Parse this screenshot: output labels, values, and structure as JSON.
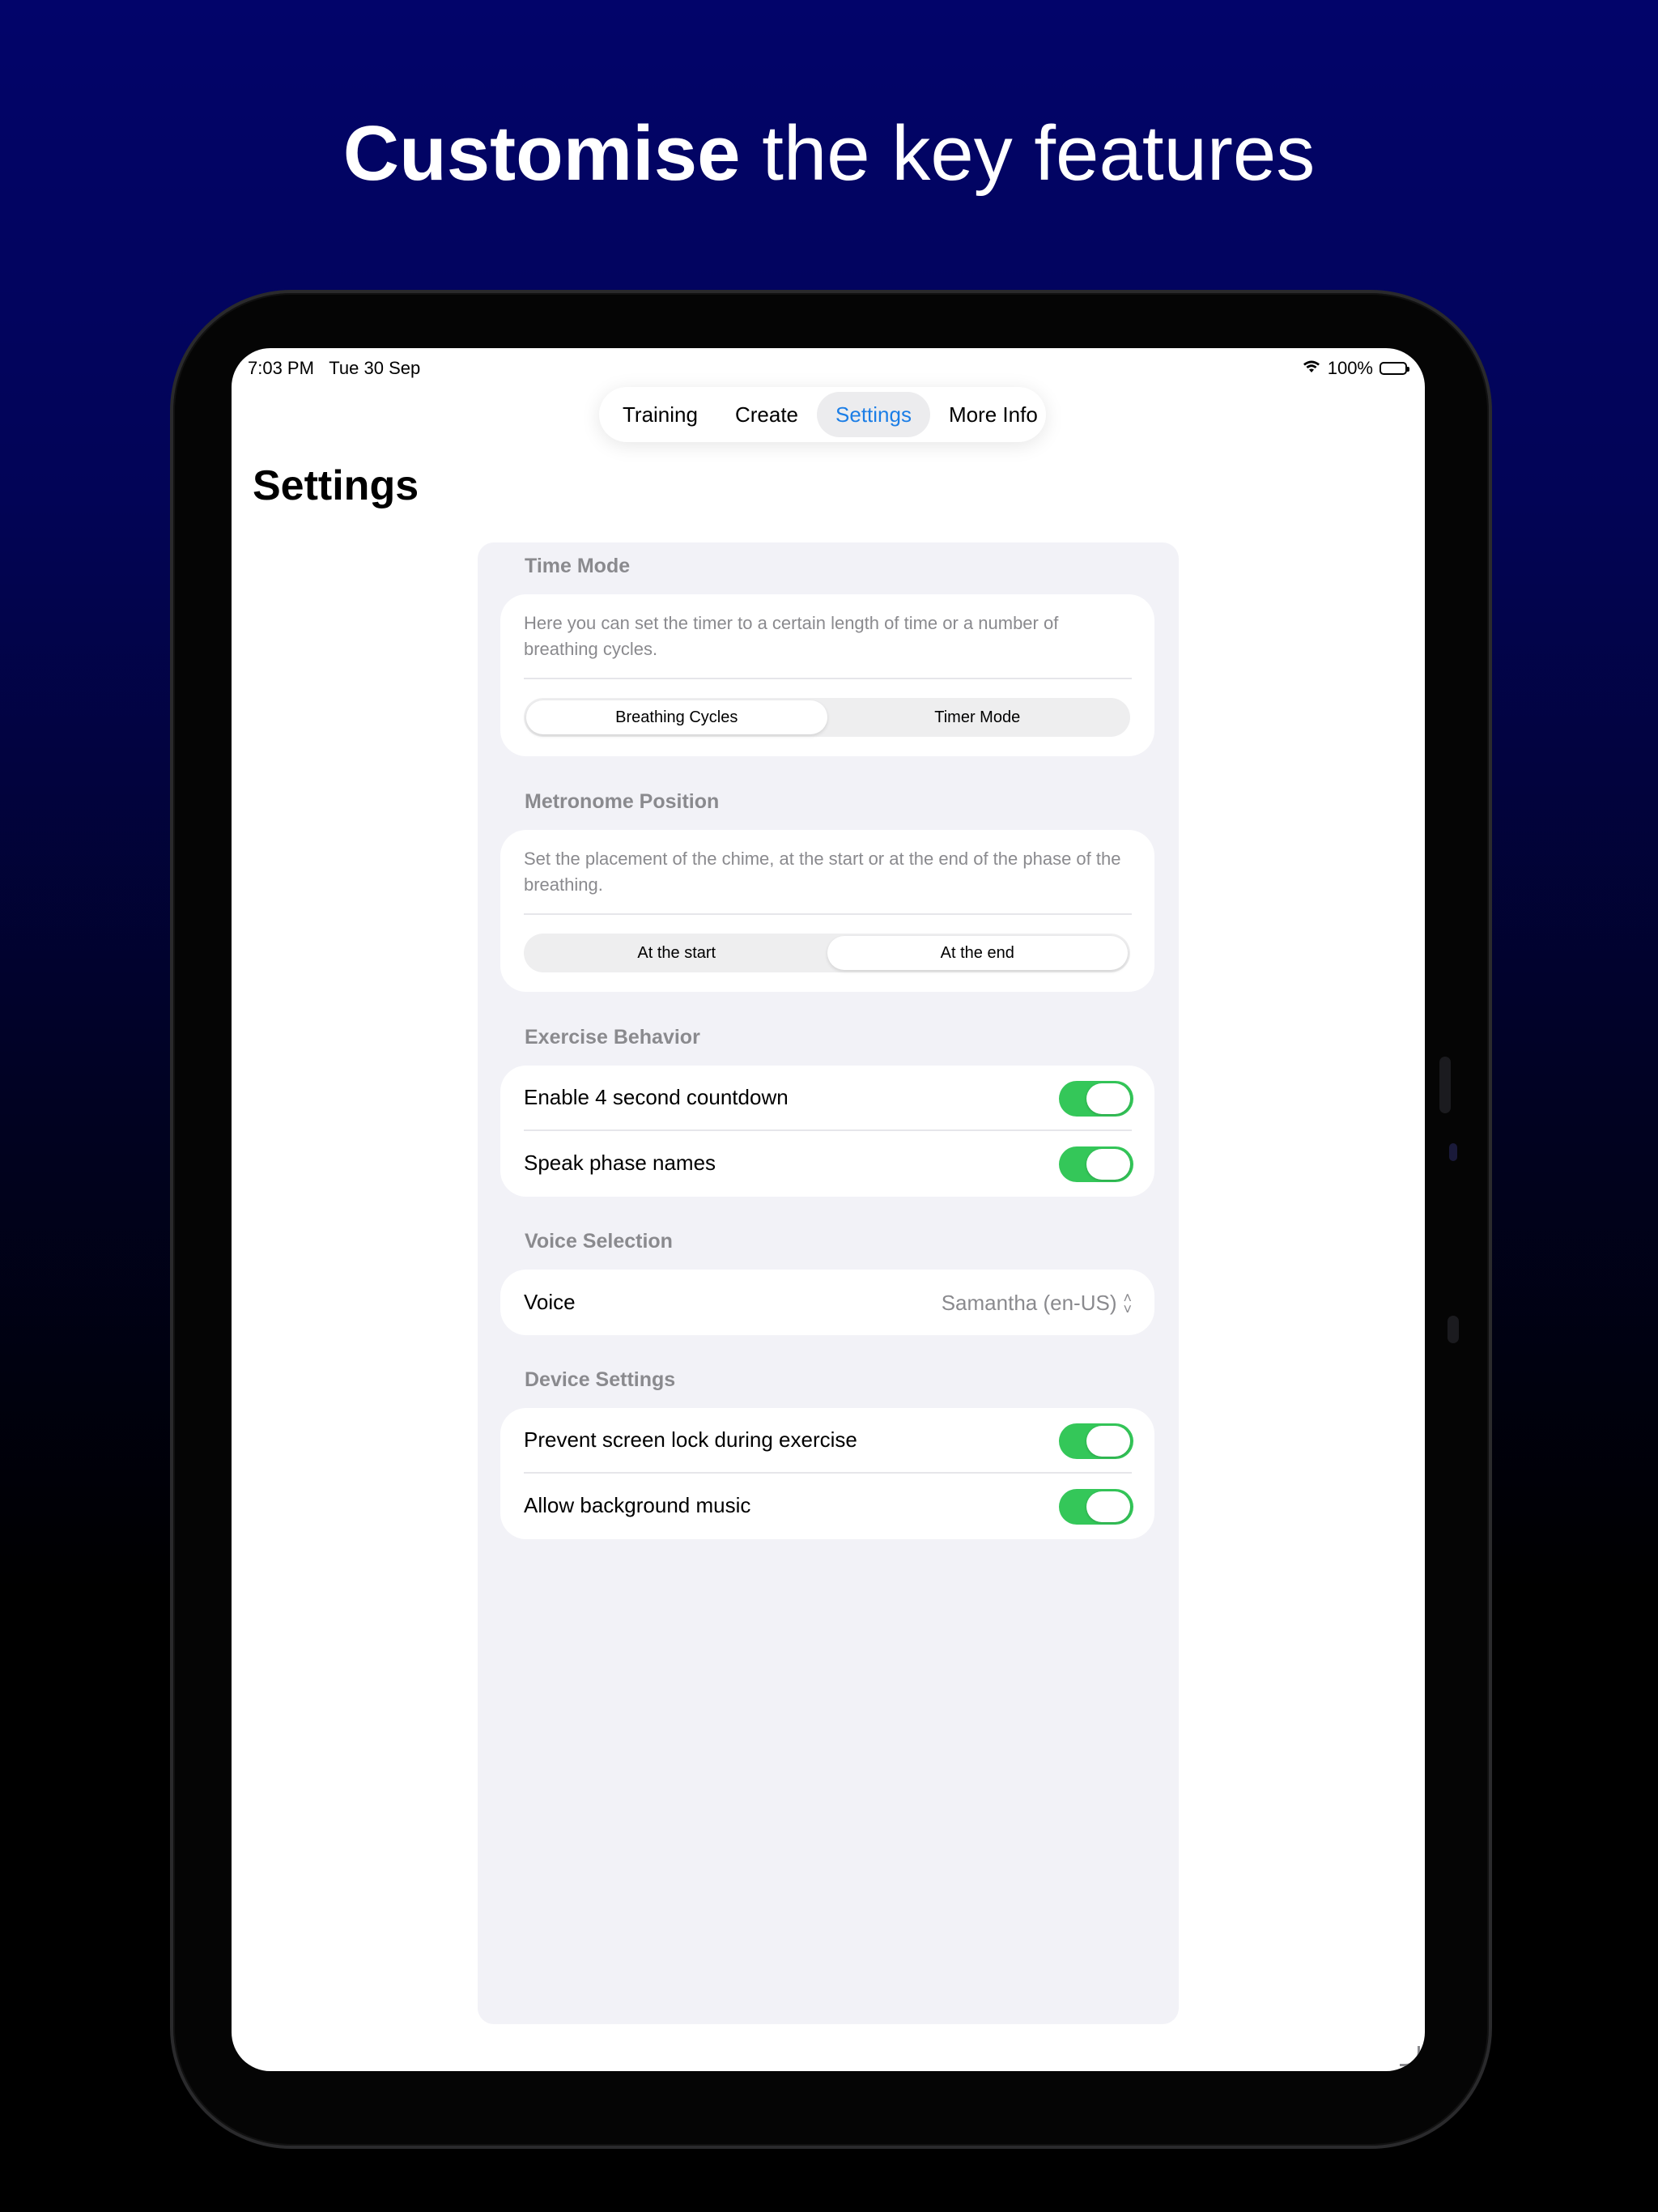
{
  "headline": {
    "bold": "Customise",
    "rest": " the key features"
  },
  "status_bar": {
    "time": "7:03 PM",
    "date": "Tue 30 Sep",
    "battery": "100%"
  },
  "tabs": [
    {
      "label": "Training",
      "active": false
    },
    {
      "label": "Create",
      "active": false
    },
    {
      "label": "Settings",
      "active": true
    },
    {
      "label": "More Info",
      "active": false
    }
  ],
  "page_title": "Settings",
  "sections": {
    "time_mode": {
      "header": "Time Mode",
      "description": "Here you can set the timer to a certain length of time or a number of breathing cycles.",
      "options": [
        "Breathing Cycles",
        "Timer Mode"
      ],
      "selected": "Breathing Cycles"
    },
    "metronome": {
      "header": "Metronome Position",
      "description": "Set the placement of the chime, at the start or at the end of the phase of the breathing.",
      "options": [
        "At the start",
        "At the end"
      ],
      "selected": "At the end"
    },
    "exercise": {
      "header": "Exercise Behavior",
      "rows": [
        {
          "label": "Enable 4 second countdown",
          "on": true
        },
        {
          "label": "Speak phase names",
          "on": true
        }
      ]
    },
    "voice": {
      "header": "Voice Selection",
      "label": "Voice",
      "value": "Samantha (en-US)"
    },
    "device": {
      "header": "Device Settings",
      "rows": [
        {
          "label": "Prevent screen lock during exercise",
          "on": true
        },
        {
          "label": "Allow background music",
          "on": true
        }
      ]
    }
  },
  "colors": {
    "accent": "#1c7ee6",
    "toggle_on": "#34c759",
    "background_top": "#02046a"
  }
}
